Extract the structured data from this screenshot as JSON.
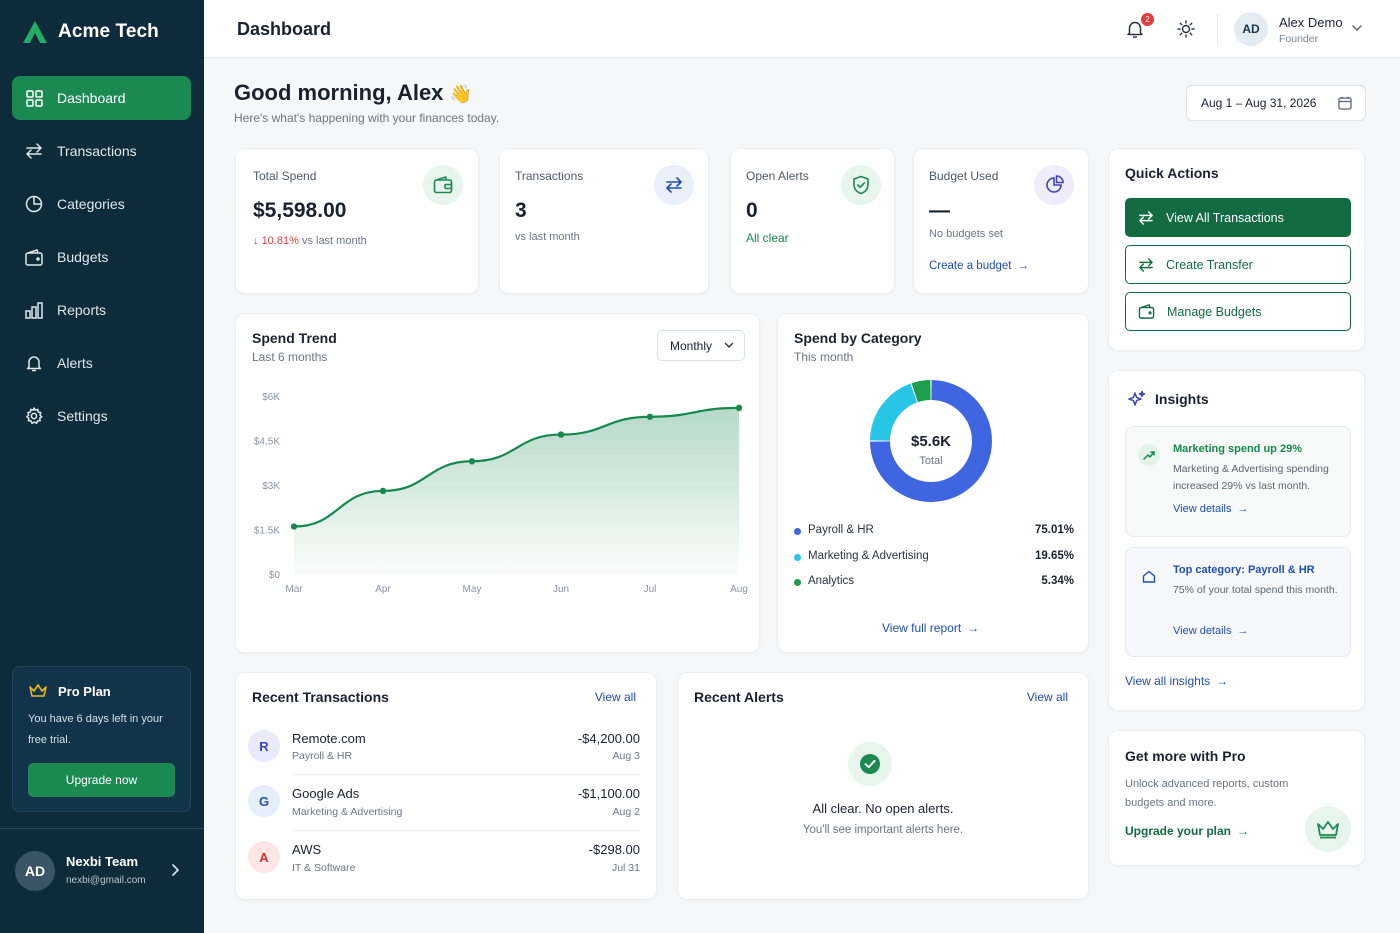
{
  "sidebar": {
    "brand": "Acme Tech",
    "nav": [
      {
        "label": "Dashboard",
        "icon": "grid-icon",
        "active": true
      },
      {
        "label": "Transactions",
        "icon": "transfer-icon"
      },
      {
        "label": "Categories",
        "icon": "pie-icon"
      },
      {
        "label": "Budgets",
        "icon": "wallet-icon"
      },
      {
        "label": "Reports",
        "icon": "bar-chart-icon"
      },
      {
        "label": "Alerts",
        "icon": "bell-icon"
      },
      {
        "label": "Settings",
        "icon": "gear-icon"
      }
    ],
    "plan": {
      "title": "Pro Plan",
      "text": "You have 6 days left in your free trial.",
      "button": "Upgrade now"
    },
    "user": {
      "initials": "AD",
      "name": "Nexbi Team",
      "email": "nexbi@gmail.com"
    }
  },
  "header": {
    "title": "Dashboard",
    "notifications": "2",
    "user": {
      "initials": "AD",
      "name": "Alex Demo",
      "role": "Founder"
    }
  },
  "greeting": {
    "title": "Good morning, Alex",
    "emoji": "👋",
    "subtitle": "Here's what's happening with your finances today.",
    "date_range": "Aug 1 – Aug 31, 2026"
  },
  "stats": {
    "total_spend": {
      "label": "Total Spend",
      "value": "$5,598.00",
      "change": "10.81%",
      "change_suffix": "vs last month"
    },
    "transactions": {
      "label": "Transactions",
      "value": "3",
      "sub": "vs last month"
    },
    "open_alerts": {
      "label": "Open Alerts",
      "value": "0",
      "sub": "All clear"
    },
    "budget_used": {
      "label": "Budget Used",
      "value": "—",
      "sub": "No budgets set",
      "link": "Create a budget"
    }
  },
  "quick_actions": {
    "title": "Quick Actions",
    "buttons": [
      "View All Transactions",
      "Create Transfer",
      "Manage Budgets"
    ]
  },
  "spend_trend": {
    "title": "Spend Trend",
    "subtitle": "Last 6 months",
    "period": "Monthly"
  },
  "spend_by_category": {
    "title": "Spend by Category",
    "subtitle": "This month",
    "total_value": "$5.6K",
    "total_label": "Total",
    "items": [
      {
        "label": "Payroll & HR",
        "pct": "75.01%"
      },
      {
        "label": "Marketing & Advertising",
        "pct": "19.65%"
      },
      {
        "label": "Analytics",
        "pct": "5.34%"
      }
    ],
    "link": "View full report"
  },
  "insights": {
    "title": "Insights",
    "items": [
      {
        "title": "Marketing spend up 29%",
        "body": "Marketing & Advertising spending increased 29% vs last month.",
        "link": "View details"
      },
      {
        "title": "Top category: Payroll & HR",
        "body": "75% of your total spend this month.",
        "link": "View details"
      }
    ],
    "view_all": "View all insights"
  },
  "recent_transactions": {
    "title": "Recent Transactions",
    "view_all": "View all",
    "rows": [
      {
        "initial": "R",
        "name": "Remote.com",
        "category": "Payroll & HR",
        "amount": "-$4,200.00",
        "date": "Aug 3"
      },
      {
        "initial": "G",
        "name": "Google Ads",
        "category": "Marketing & Advertising",
        "amount": "-$1,100.00",
        "date": "Aug 2"
      },
      {
        "initial": "A",
        "name": "AWS",
        "category": "IT & Software",
        "amount": "-$298.00",
        "date": "Jul 31"
      }
    ]
  },
  "recent_alerts": {
    "title": "Recent Alerts",
    "view_all": "View all",
    "empty_title": "All clear. No open alerts.",
    "empty_sub": "You'll see important alerts here."
  },
  "pro_promo": {
    "title": "Get more with Pro",
    "body": "Unlock advanced reports, custom budgets and more.",
    "link": "Upgrade your plan"
  },
  "colors": {
    "sidebar": "#0d2b3a",
    "accent": "#1a8a52",
    "primary_dark": "#136b42",
    "link": "#1f4fb3",
    "negative": "#e23d3d"
  },
  "chart_data": [
    {
      "type": "area",
      "x": [
        "Mar",
        "Apr",
        "May",
        "Jun",
        "Jul",
        "Aug"
      ],
      "series": [
        {
          "values": [
            1600,
            2800,
            3800,
            4700,
            5300,
            5600
          ]
        }
      ],
      "y_ticks": [
        "$6K",
        "$4.5K",
        "$3K",
        "$1.5K",
        "$0"
      ],
      "ylim": [
        0,
        6000
      ],
      "grid": false
    },
    {
      "type": "pie",
      "labels": [
        "Payroll & HR",
        "Marketing & Advertising",
        "Analytics"
      ],
      "values": [
        75.01,
        19.65,
        5.34
      ],
      "colors": [
        "#3f66e0",
        "#27c5e6",
        "#1f9e4d"
      ],
      "center_label": "$5.6K"
    }
  ]
}
